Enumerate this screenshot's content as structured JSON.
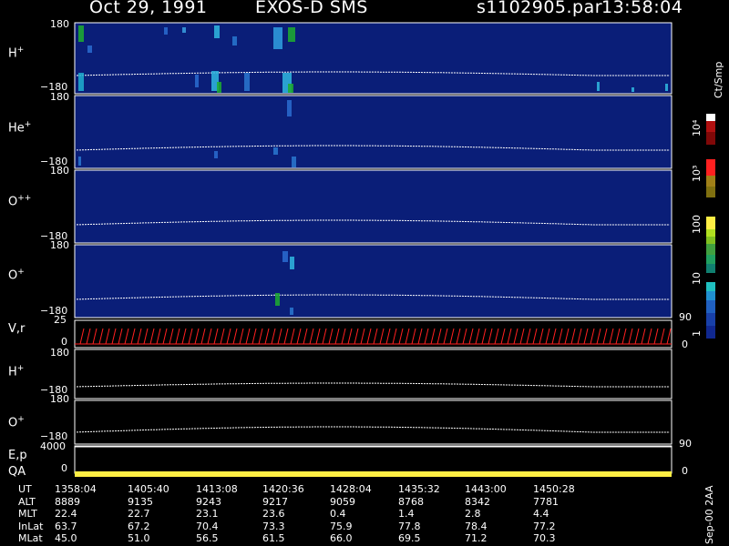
{
  "header": {
    "date": "Oct 29, 1991",
    "mission": "EXOS-D SMS",
    "file": "s1102905.par",
    "time": "13:58:04"
  },
  "colors": {
    "background": "#000000",
    "panel_fill": "#0a1e78",
    "trace": "#ffffff",
    "vr_arrows": "#ff2020",
    "qa_bar": "#ffee44"
  },
  "chart_data": {
    "type": "heatmap",
    "panels": [
      {
        "id": "h_plus_spec",
        "label": "H",
        "superscript": "+",
        "y_top": "180",
        "y_bottom": "−180",
        "type": "heatmap"
      },
      {
        "id": "he_plus_spec",
        "label": "He",
        "superscript": "+",
        "y_top": "180",
        "y_bottom": "−180",
        "type": "heatmap"
      },
      {
        "id": "o_pp_spec",
        "label": "O",
        "superscript": "++",
        "y_top": "180",
        "y_bottom": "−180",
        "type": "heatmap"
      },
      {
        "id": "o_plus_spec",
        "label": "O",
        "superscript": "+",
        "y_top": "180",
        "y_bottom": "−180",
        "type": "heatmap"
      },
      {
        "id": "vr",
        "label": "V,r",
        "y_top": "25",
        "y_bottom": "0",
        "right_top": "90",
        "right_bottom": "0",
        "type": "vector"
      },
      {
        "id": "h_plus_line",
        "label": "H",
        "superscript": "+",
        "y_top": "180",
        "y_bottom": "−180",
        "type": "line"
      },
      {
        "id": "o_plus_line",
        "label": "O",
        "superscript": "+",
        "y_top": "180",
        "y_bottom": "−180",
        "type": "line"
      },
      {
        "id": "ep",
        "label": "E,p",
        "y_top": "4000",
        "right_top": "90",
        "type": "line"
      },
      {
        "id": "qa",
        "label": "QA",
        "y_bottom": "0",
        "right_bottom": "0",
        "type": "bar"
      }
    ],
    "colorbar": {
      "label": "Ct/Smp",
      "tick_labels": [
        "10⁴",
        "10³",
        "100",
        "10",
        "1"
      ]
    },
    "table": {
      "rows": [
        {
          "name": "UT",
          "values": [
            "1358:04",
            "1405:40",
            "1413:08",
            "1420:36",
            "1428:04",
            "1435:32",
            "1443:00",
            "1450:28"
          ]
        },
        {
          "name": "ALT",
          "values": [
            "8889",
            "9135",
            "9243",
            "9217",
            "9059",
            "8768",
            "8342",
            "7781"
          ]
        },
        {
          "name": "MLT",
          "values": [
            "22.4",
            "22.7",
            "23.1",
            "23.6",
            "0.4",
            "1.4",
            "2.8",
            "4.4"
          ]
        },
        {
          "name": "InLat",
          "values": [
            "63.7",
            "67.2",
            "70.4",
            "73.3",
            "75.9",
            "77.8",
            "78.4",
            "77.2"
          ]
        },
        {
          "name": "MLat",
          "values": [
            "45.0",
            "51.0",
            "56.5",
            "61.5",
            "66.0",
            "69.5",
            "71.2",
            "70.3"
          ]
        }
      ]
    },
    "footer_note": "Sep-00 2AA"
  }
}
